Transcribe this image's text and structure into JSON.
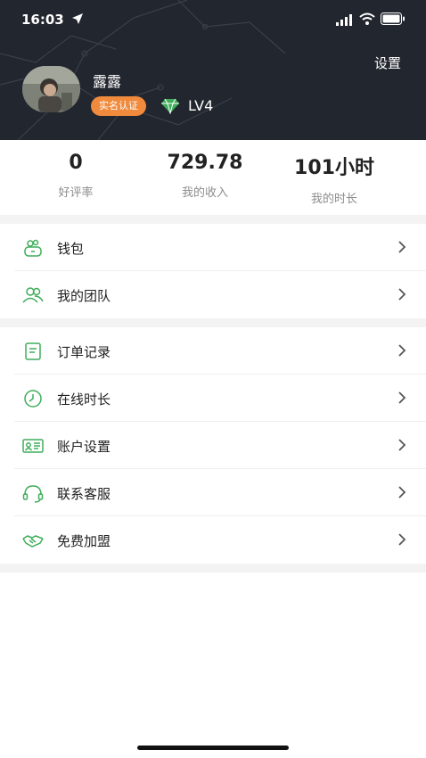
{
  "status_bar": {
    "time": "16:03"
  },
  "header": {
    "settings_label": "设置",
    "username": "露露",
    "verify_badge": "实名认证",
    "level": "LV4",
    "background_color": "#22262f",
    "badge_color": "#f08a3c",
    "diamond_color": "#3fae5a"
  },
  "stats": [
    {
      "value": "0",
      "label": "好评率"
    },
    {
      "value": "729.78",
      "label": "我的收入"
    },
    {
      "value": "101小时",
      "label": "我的时长"
    }
  ],
  "menu_groups": [
    {
      "items": [
        {
          "label": "钱包",
          "icon": "wallet-icon"
        },
        {
          "label": "我的团队",
          "icon": "team-icon"
        }
      ]
    },
    {
      "items": [
        {
          "label": "订单记录",
          "icon": "order-record-icon"
        },
        {
          "label": "在线时长",
          "icon": "clock-icon"
        },
        {
          "label": "账户设置",
          "icon": "id-card-icon"
        },
        {
          "label": "联系客服",
          "icon": "headset-icon"
        },
        {
          "label": "免费加盟",
          "icon": "handshake-icon"
        }
      ]
    }
  ],
  "accent_color": "#3fae5a"
}
